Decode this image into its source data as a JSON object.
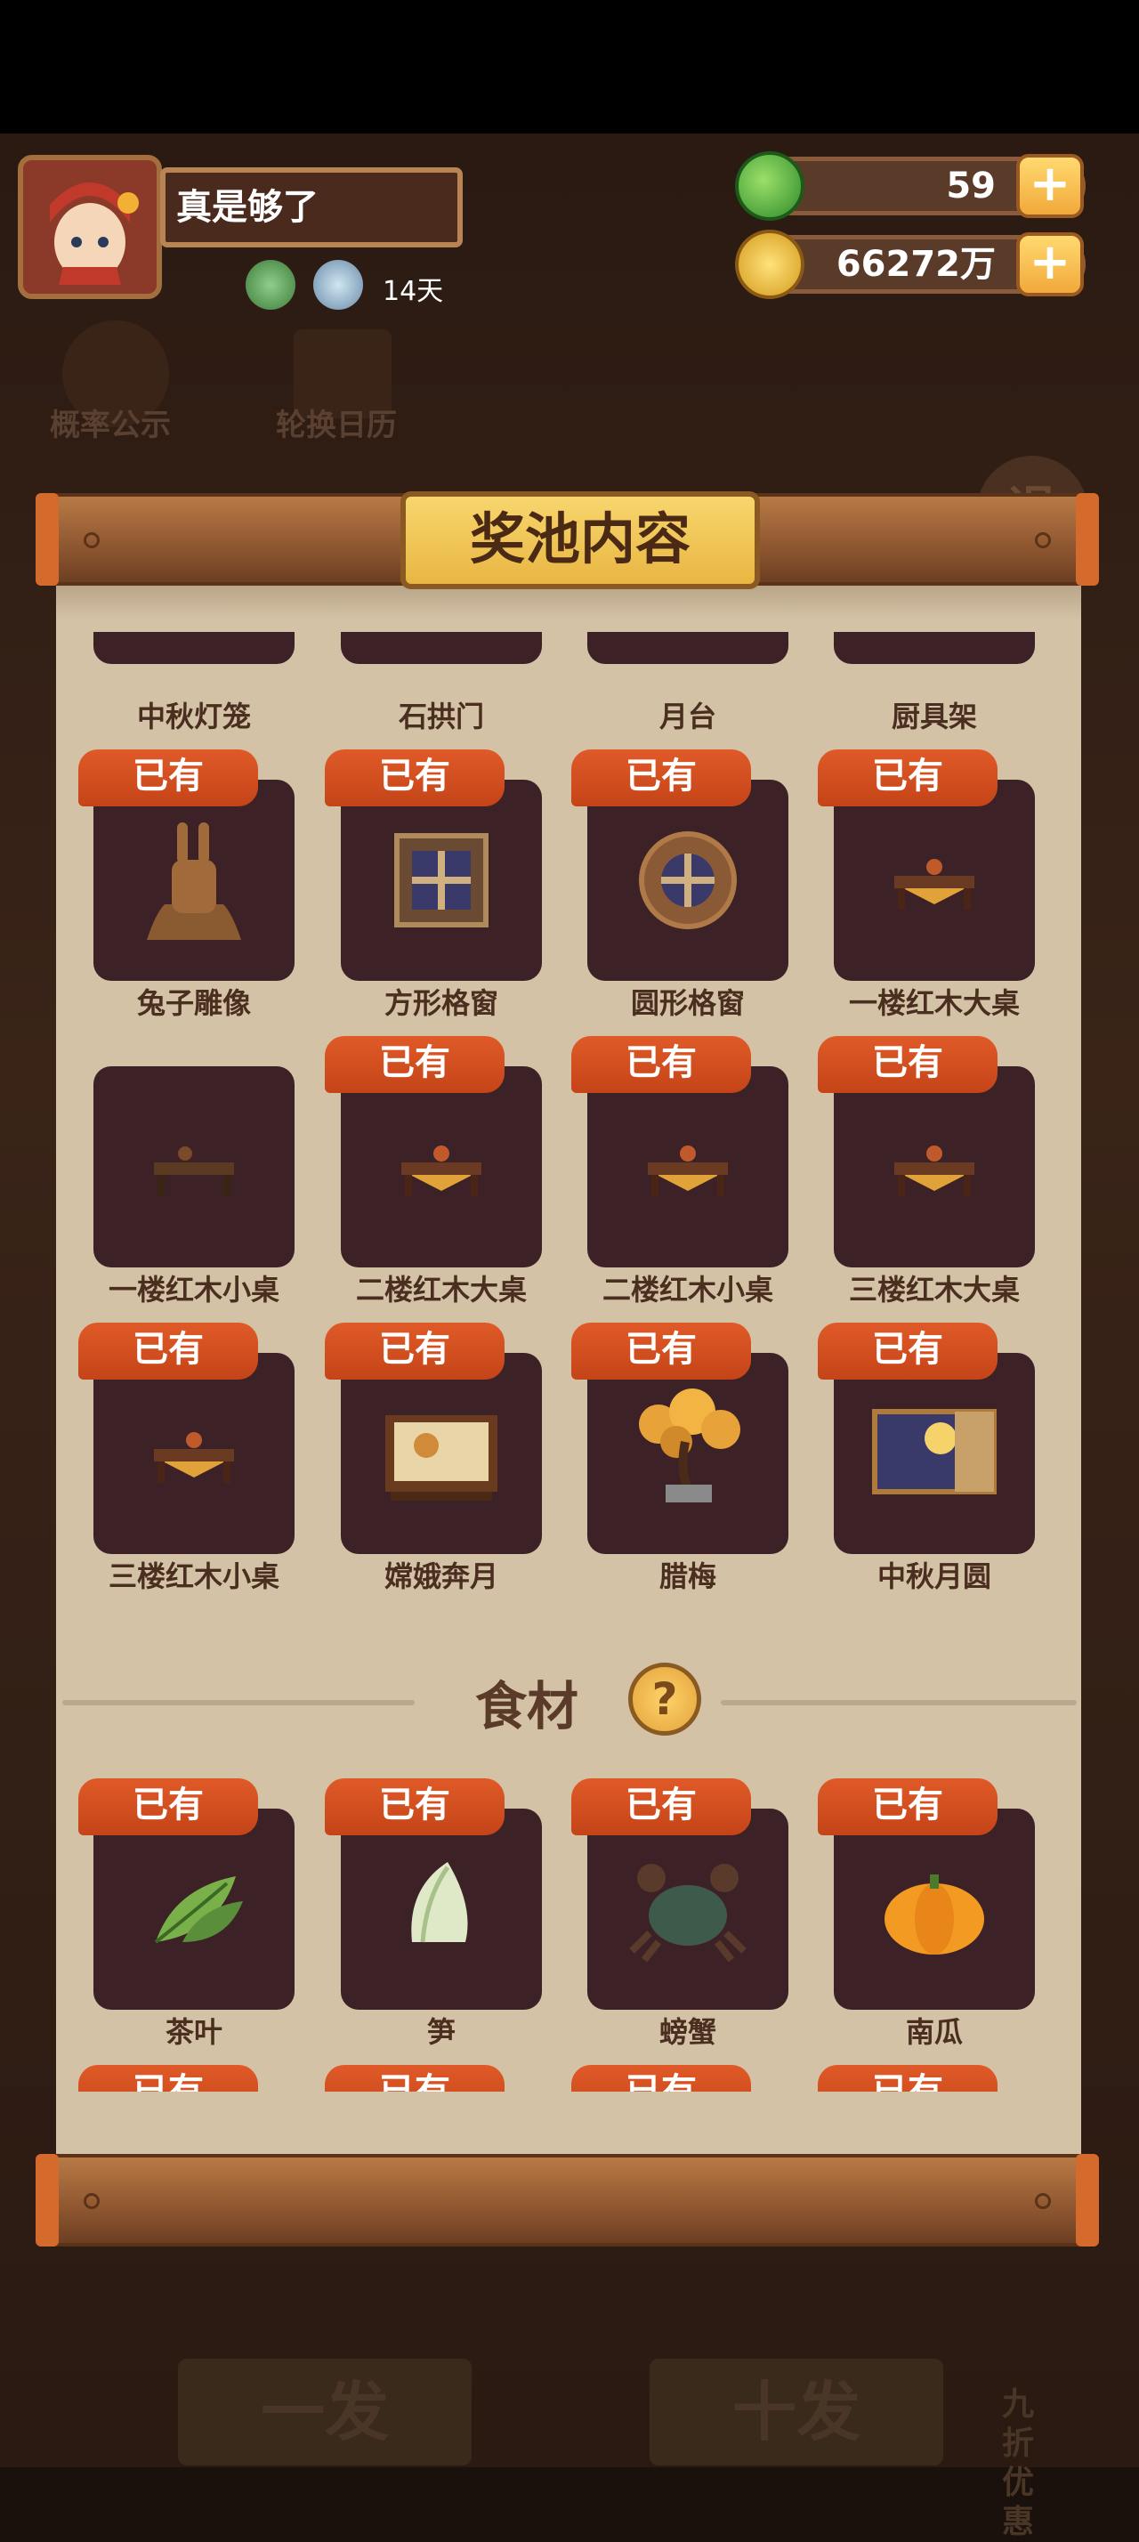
{
  "player": {
    "name": "真是够了",
    "days": "14天"
  },
  "currencies": {
    "green_value": "59",
    "coin_value": "66272万"
  },
  "background": {
    "prob_label": "概率公示",
    "rotation_label": "轮换日历",
    "exit_label": "退",
    "one_draw": "一发",
    "ten_draw": "十发",
    "discount": "九折优惠"
  },
  "panel": {
    "title": "奖池内容",
    "owned_badge": "已有"
  },
  "top_partial_items": [
    "中秋灯笼",
    "石拱门",
    "月台",
    "厨具架"
  ],
  "furniture_items": [
    {
      "label": "兔子雕像",
      "owned": true,
      "icon": "rabbit-statue-icon"
    },
    {
      "label": "方形格窗",
      "owned": true,
      "icon": "square-lattice-window-icon"
    },
    {
      "label": "圆形格窗",
      "owned": true,
      "icon": "round-lattice-window-icon"
    },
    {
      "label": "一楼红木大桌",
      "owned": true,
      "icon": "table-icon"
    },
    {
      "label": "一楼红木小桌",
      "owned": false,
      "icon": "table-icon"
    },
    {
      "label": "二楼红木大桌",
      "owned": true,
      "icon": "table-icon"
    },
    {
      "label": "二楼红木小桌",
      "owned": true,
      "icon": "table-icon"
    },
    {
      "label": "三楼红木大桌",
      "owned": true,
      "icon": "table-icon"
    },
    {
      "label": "三楼红木小桌",
      "owned": true,
      "icon": "table-icon"
    },
    {
      "label": "嫦娥奔月",
      "owned": true,
      "icon": "painting-screen-icon"
    },
    {
      "label": "腊梅",
      "owned": true,
      "icon": "bonsai-tree-icon"
    },
    {
      "label": "中秋月圆",
      "owned": true,
      "icon": "moon-screen-icon"
    }
  ],
  "ingredients_section": {
    "title": "食材",
    "help_label": "?"
  },
  "ingredient_items": [
    {
      "label": "茶叶",
      "owned": true,
      "icon": "tea-leaf-icon"
    },
    {
      "label": "笋",
      "owned": true,
      "icon": "bamboo-shoot-icon"
    },
    {
      "label": "螃蟹",
      "owned": true,
      "icon": "crab-icon"
    },
    {
      "label": "南瓜",
      "owned": true,
      "icon": "pumpkin-icon"
    }
  ]
}
